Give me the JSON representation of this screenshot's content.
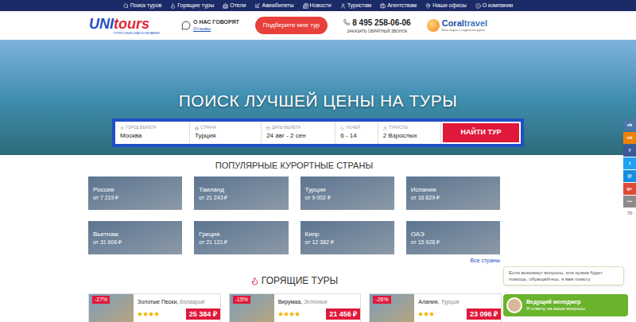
{
  "nav": [
    {
      "label": "Поиск туров"
    },
    {
      "label": "Горящие туры"
    },
    {
      "label": "Отели"
    },
    {
      "label": "Авиабилеты"
    },
    {
      "label": "Новости"
    },
    {
      "label": "Туристам"
    },
    {
      "label": "Агентствам"
    },
    {
      "label": "Наши офисы"
    },
    {
      "label": "О компании"
    }
  ],
  "header": {
    "logo": {
      "part1": "UNI",
      "part2": "tours",
      "tagline": "ТУРИСТИЧЕСКАЯ КОМПАНИЯ"
    },
    "reviews": {
      "title": "О НАС ГОВОРЯТ",
      "link": "Отзывы"
    },
    "pick_button": "Подберите мне тур",
    "phone": "8 495 258-06-06",
    "callback": "ЗАКАЗАТЬ ОБРАТНЫЙ ЗВОНОК",
    "partner": {
      "part1": "Coral",
      "part2": "travel",
      "tagline": "Ваш отдых в надежных руках"
    }
  },
  "hero": {
    "title": "ПОИСК ЛУЧШЕЙ ЦЕНЫ НА ТУРЫ"
  },
  "search": {
    "fields": [
      {
        "label": "ГОРОД ВЫЛЕТА",
        "value": "Москва"
      },
      {
        "label": "СТРАНА",
        "value": "Турция"
      },
      {
        "label": "ДАТЫ ВЫЛЕТА",
        "value": "24 авг - 2 сен"
      },
      {
        "label": "НОЧЕЙ",
        "value": "6 - 14"
      },
      {
        "label": "ТУРИСТЫ",
        "value": "2 Взрослых"
      }
    ],
    "button": "НАЙТИ ТУР"
  },
  "countries": {
    "title": "ПОПУЛЯРНЫЕ КУРОРТНЫЕ СТРАНЫ",
    "items": [
      {
        "name": "Россия",
        "price": "от 7 219 ₽"
      },
      {
        "name": "Таиланд",
        "price": "от 21 243 ₽"
      },
      {
        "name": "Турция",
        "price": "от 9 002 ₽"
      },
      {
        "name": "Испания",
        "price": "от 16 829 ₽"
      },
      {
        "name": "Вьетнам",
        "price": "от 31 606 ₽"
      },
      {
        "name": "Греция",
        "price": "от 21 121 ₽"
      },
      {
        "name": "Кипр",
        "price": "от 12 382 ₽"
      },
      {
        "name": "ОАЭ",
        "price": "от 15 928 ₽"
      }
    ],
    "all_link": "Все страны"
  },
  "hot_tours": {
    "title": "ГОРЯЩИЕ ТУРЫ",
    "items": [
      {
        "discount": "-27%",
        "name": "Золотые Пески,",
        "country": "Болгария",
        "stars": 4,
        "price": "25 384 ₽"
      },
      {
        "discount": "-15%",
        "name": "Вирумаа,",
        "country": "Эстония",
        "stars": 4,
        "price": "21 456 ₽"
      },
      {
        "discount": "-26%",
        "name": "Алания,",
        "country": "Турция",
        "stars": 3,
        "price": "23 096 ₽"
      }
    ]
  },
  "social": {
    "items": [
      {
        "glyph": "vk",
        "color": "#4a76a8"
      },
      {
        "glyph": "ok",
        "color": "#ee8208"
      },
      {
        "glyph": "f",
        "color": "#3b5998"
      },
      {
        "glyph": "t",
        "color": "#1da1f2"
      },
      {
        "glyph": "@",
        "color": "#168de2"
      },
      {
        "glyph": "g+",
        "color": "#dd4b39"
      },
      {
        "glyph": "•••",
        "color": "#8c8c8c"
      }
    ],
    "count": "70"
  },
  "chat": {
    "bubble": "Если возникнут вопросы, или нужна будет помощь, обращайтесь, я вам помогу",
    "title": "Ведущий менеджер",
    "subtitle": "Я отвечу на ваши вопросы"
  }
}
